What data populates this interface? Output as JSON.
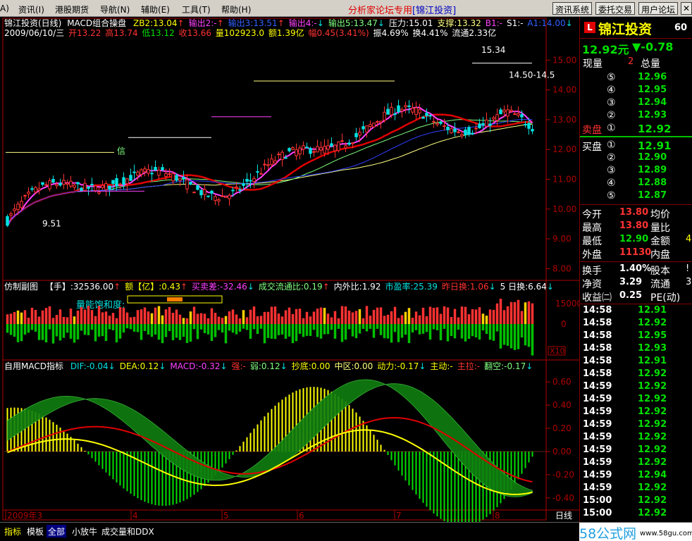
{
  "menu": {
    "items": [
      "A)",
      "资讯(I)",
      "港股期货",
      "导航(N)",
      "辅助(E)",
      "工具(T)",
      "帮助(H)"
    ],
    "brand_text": "分析家论坛专用",
    "brand_sub": "[锦江投资]",
    "right_buttons": [
      "资讯系统",
      "委托交易",
      "用户论坛"
    ],
    "close_glyph": "✕"
  },
  "colors": {
    "up": "#ff3232",
    "down": "#00e0e0",
    "bg": "#000000",
    "frame": "#b00000",
    "ma_red": "#e00000",
    "ma_yellow": "#ffff80",
    "ma_green": "#80ff80",
    "ma_blue": "#3040ff",
    "vol_up": "#ff3232",
    "vol_down": "#00c000",
    "vol_yellow": "#ffd000"
  },
  "header": {
    "line1": {
      "title": "锦江投资(日线)",
      "indicator": "MACD组合操盘",
      "items": [
        {
          "text": "ZB2:13.04",
          "color": "#ffff00",
          "arrow": "↑",
          "arrow_color": "#ff3232"
        },
        {
          "text": "输出2:-",
          "color": "#ff40ff",
          "arrow": "↑",
          "arrow_color": "#ff3232"
        },
        {
          "text": "输出3:13.51",
          "color": "#3060ff",
          "arrow": "↑",
          "arrow_color": "#ff3232"
        },
        {
          "text": "输出4:-",
          "color": "#ff40ff",
          "arrow": "↓",
          "arrow_color": "#00e0e0"
        },
        {
          "text": "输出5:13.47",
          "color": "#80ff80",
          "arrow": "↓",
          "arrow_color": "#00e0e0"
        },
        {
          "text": "压力:15.01",
          "color": "#ffffff",
          "arrow": "",
          "arrow_color": ""
        },
        {
          "text": "支撑:13.32",
          "color": "#ffff80",
          "arrow": "",
          "arrow_color": ""
        },
        {
          "text": "B1:-",
          "color": "#ff40ff",
          "arrow": "",
          "arrow_color": ""
        },
        {
          "text": "S1:-",
          "color": "#ffffff",
          "arrow": "",
          "arrow_color": ""
        },
        {
          "text": "A1:14.00",
          "color": "#3060ff",
          "arrow": "↓",
          "arrow_color": "#00e0e0"
        }
      ]
    },
    "line2": {
      "date": "2009/06/10/三",
      "open": "开13.22",
      "high": "高13.74",
      "low": "低13.12",
      "close": "收13.66",
      "vol": "量102923.0",
      "amount": "额1.39亿",
      "range": "幅0.45(3.41%)",
      "amp": "振4.69%",
      "turnover": "换4.41%",
      "float": "流通2.33亿"
    },
    "vol_line": {
      "name": "仿制副图",
      "items": [
        {
          "text": "【手】:32536.00",
          "color": "#ffffff",
          "arrow": "↑",
          "arrow_color": "#ff3232"
        },
        {
          "text": "额【亿】:0.43",
          "color": "#ffff00",
          "arrow": "↑",
          "arrow_color": "#ff3232"
        },
        {
          "text": "买卖差:-32.46",
          "color": "#ff40ff",
          "arrow": "↓",
          "arrow_color": "#00e0e0"
        },
        {
          "text": "成交流通比:0.19",
          "color": "#80ff80",
          "arrow": "↑",
          "arrow_color": "#ff3232"
        },
        {
          "text": "内外比:1.92",
          "color": "#ffffff",
          "arrow": "",
          "arrow_color": ""
        },
        {
          "text": "市盈率:25.39",
          "color": "#00e0e0",
          "arrow": "",
          "arrow_color": ""
        },
        {
          "text": "昨日换:1.06",
          "color": "#ff3232",
          "arrow": "↓",
          "arrow_color": "#00e0e0"
        },
        {
          "text": "5 日换:6.64",
          "color": "#ffffff",
          "arrow": "↓",
          "arrow_color": "#00e0e0"
        }
      ],
      "saturation_label": "量能饱和度:"
    },
    "macd_line": {
      "name": "自用MACD指标",
      "items": [
        {
          "text": "DIF:-0.04",
          "color": "#00e0e0",
          "arrow": "↓",
          "arrow_color": "#00e0e0"
        },
        {
          "text": "DEA:0.12",
          "color": "#ffff00",
          "arrow": "↓",
          "arrow_color": "#00e0e0"
        },
        {
          "text": "MACD:-0.32",
          "color": "#ff40ff",
          "arrow": "↓",
          "arrow_color": "#00e0e0"
        },
        {
          "text": "强:-",
          "color": "#ff3232",
          "arrow": "",
          "arrow_color": ""
        },
        {
          "text": "弱:0.12",
          "color": "#80ff80",
          "arrow": "↓",
          "arrow_color": "#00e0e0"
        },
        {
          "text": "抄底:0.00",
          "color": "#ffff00",
          "arrow": "",
          "arrow_color": ""
        },
        {
          "text": "中区:0.00",
          "color": "#ffff80",
          "arrow": "",
          "arrow_color": ""
        },
        {
          "text": "动力:-0.17",
          "color": "#ffff00",
          "arrow": "↓",
          "arrow_color": "#00e0e0"
        },
        {
          "text": "主动:-",
          "color": "#ffff00",
          "arrow": "",
          "arrow_color": ""
        },
        {
          "text": "主拉:-",
          "color": "#ff3232",
          "arrow": "",
          "arrow_color": ""
        },
        {
          "text": "翻空:-0.17",
          "color": "#80ff80",
          "arrow": "↓",
          "arrow_color": "#00e0e0"
        }
      ]
    }
  },
  "chart_data": [
    {
      "type": "candlestick",
      "title": "锦江投资(日线)",
      "y_ticks": [
        "15.00",
        "14.00",
        "13.00",
        "12.00",
        "11.00",
        "10.00",
        "9.00",
        "8.00"
      ],
      "ylim": [
        7.7,
        15.6
      ],
      "annotations": [
        "15.34",
        "14.50-14.5",
        "9.51"
      ],
      "signal_label": "信"
    },
    {
      "type": "bar",
      "title": "仿制副图",
      "y_ticks": [
        "15000",
        "0"
      ],
      "unit_label": "X10"
    },
    {
      "type": "bar",
      "title": "自用MACD指标",
      "y_ticks": [
        "0.60",
        "0.40",
        "0.20",
        "0.00",
        "-0.20",
        "-0.40"
      ]
    }
  ],
  "x_axis": {
    "labels": [
      "2009年3",
      "4",
      "5",
      "6",
      "7",
      "8"
    ],
    "period": "日线"
  },
  "quote": {
    "stock_name": "锦江投资",
    "stock_code_part": "60",
    "logo_letter": "L",
    "price": "12.92元",
    "change": "▼-0.78",
    "now_vol_label": "现量",
    "now_vol": "2",
    "total_label": "总量",
    "sell_label": "卖盘",
    "buy_label": "买盘",
    "sells": [
      {
        "level": "⑤",
        "price": "12.96"
      },
      {
        "level": "④",
        "price": "12.95"
      },
      {
        "level": "③",
        "price": "12.94"
      },
      {
        "level": "②",
        "price": "12.93"
      },
      {
        "level": "①",
        "price": "12.92"
      }
    ],
    "buys": [
      {
        "level": "①",
        "price": "12.91"
      },
      {
        "level": "②",
        "price": "12.90"
      },
      {
        "level": "③",
        "price": "12.89"
      },
      {
        "level": "④",
        "price": "12.88"
      },
      {
        "level": "⑤",
        "price": "12.87"
      }
    ],
    "stats": [
      {
        "l1": "今开",
        "v1": "13.80",
        "c1": "#ff3232",
        "l2": "均价",
        "v2": ""
      },
      {
        "l1": "最高",
        "v1": "13.80",
        "c1": "#ff3232",
        "l2": "量比",
        "v2": ""
      },
      {
        "l1": "最低",
        "v1": "12.90",
        "c1": "#00e000",
        "l2": "金额",
        "v2": "4"
      },
      {
        "l1": "外盘",
        "v1": "11130",
        "c1": "#ff3232",
        "l2": "内盘",
        "v2": ""
      }
    ],
    "stats2": [
      {
        "l1": "换手",
        "v1": "1.40%",
        "l2": "股本",
        "v2": "!"
      },
      {
        "l1": "净资",
        "v1": "3.29",
        "l2": "流通",
        "v2": "3"
      },
      {
        "l1": "收益㈡",
        "v1": "0.25",
        "l2": "PE(动)",
        "v2": ""
      }
    ],
    "ticks": [
      {
        "t": "14:58",
        "p": "12.91"
      },
      {
        "t": "14:58",
        "p": "12.92"
      },
      {
        "t": "14:58",
        "p": "12.95"
      },
      {
        "t": "14:58",
        "p": "12.93"
      },
      {
        "t": "14:58",
        "p": "12.91"
      },
      {
        "t": "14:58",
        "p": "12.92"
      },
      {
        "t": "14:59",
        "p": "12.92"
      },
      {
        "t": "14:59",
        "p": "12.92"
      },
      {
        "t": "14:59",
        "p": "12.92"
      },
      {
        "t": "14:59",
        "p": "12.92"
      },
      {
        "t": "14:59",
        "p": "12.92"
      },
      {
        "t": "14:59",
        "p": "12.92"
      },
      {
        "t": "14:59",
        "p": "12.92"
      },
      {
        "t": "14:59",
        "p": "12.94"
      },
      {
        "t": "14:59",
        "p": "12.92"
      },
      {
        "t": "15:00",
        "p": "12.92"
      },
      {
        "t": "15:00",
        "p": "12.92"
      }
    ]
  },
  "tabs": {
    "items": [
      "指标",
      "模板",
      "全部",
      "小放牛",
      "成交量和DDX"
    ],
    "active": 2,
    "watermark_big": "58公式网",
    "watermark_small": "www.58gu.com"
  }
}
